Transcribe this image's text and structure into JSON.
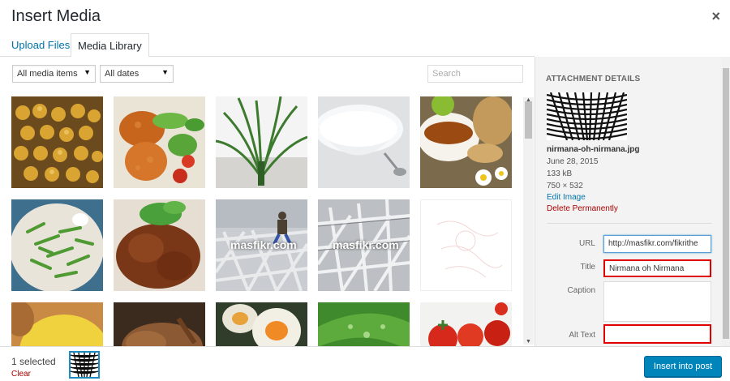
{
  "modal": {
    "title": "Insert Media",
    "close_label": "×"
  },
  "tabs": [
    {
      "label": "Upload Files"
    },
    {
      "label": "Media Library"
    }
  ],
  "toolbar": {
    "filter_type": "All media items",
    "filter_date": "All dates",
    "search_placeholder": "Search"
  },
  "grid": {
    "watermark": "masfikr.com"
  },
  "details": {
    "heading": "ATTACHMENT DETAILS",
    "filename": "nirmana-oh-nirmana.jpg",
    "date": "June 28, 2015",
    "size": "133 kB",
    "dimensions": "750 × 532",
    "edit_link": "Edit Image",
    "delete_link": "Delete Permanently",
    "fields": {
      "url_label": "URL",
      "url_value": "http://masfikr.com/fikrithe",
      "title_label": "Title",
      "title_value": "Nirmana oh Nirmana",
      "caption_label": "Caption",
      "caption_value": "",
      "alt_label": "Alt Text",
      "alt_value": ""
    }
  },
  "footer": {
    "selected": "1 selected",
    "clear": "Clear",
    "insert": "Insert into post"
  },
  "colors": {
    "accent": "#0073aa",
    "button": "#0085ba",
    "delete": "#a00000",
    "highlight": "#e00000"
  }
}
